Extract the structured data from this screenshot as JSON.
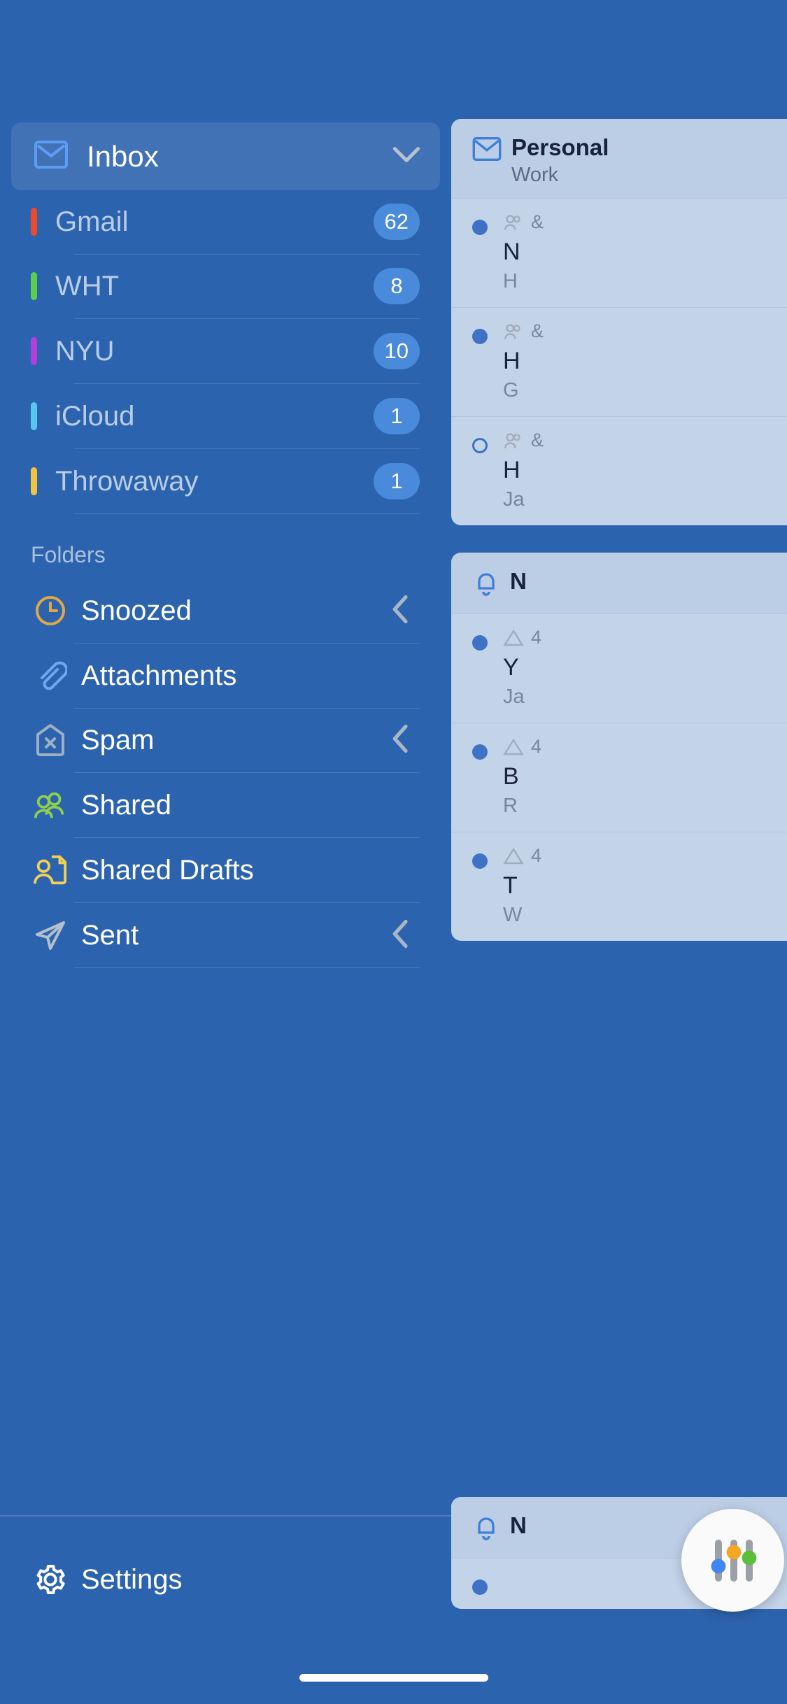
{
  "app": {
    "accent": "#2c63ae",
    "badge_color": "#4a8ada",
    "panel_color": "#c3d3e8"
  },
  "header": {
    "menu_icon": "hamburger-menu-icon"
  },
  "sidebar": {
    "inbox": {
      "label": "Inbox",
      "icon": "envelope-icon",
      "expand_icon": "chevron-down-icon",
      "expanded": true
    },
    "accounts": [
      {
        "label": "Gmail",
        "badge": "62",
        "color": "#f0482a"
      },
      {
        "label": "WHT",
        "badge": "8",
        "color": "#5ad04a"
      },
      {
        "label": "NYU",
        "badge": "10",
        "color": "#b43ddd"
      },
      {
        "label": "iCloud",
        "badge": "1",
        "color": "#56c8ef"
      },
      {
        "label": "Throwaway",
        "badge": "1",
        "color": "#f2c33c"
      }
    ],
    "folders_header": "Folders",
    "folders": [
      {
        "label": "Snoozed",
        "icon": "clock-icon",
        "icon_color": "#e0a845",
        "chevron": true
      },
      {
        "label": "Attachments",
        "icon": "paperclip-icon",
        "icon_color": "#6fa8f0",
        "chevron": false
      },
      {
        "label": "Spam",
        "icon": "spam-shield-x-icon",
        "icon_color": "#9fb0c4",
        "chevron": true
      },
      {
        "label": "Shared",
        "icon": "people-icon",
        "icon_color": "#8ed04a",
        "chevron": false
      },
      {
        "label": "Shared Drafts",
        "icon": "person-document-icon",
        "icon_color": "#f2cf55",
        "chevron": false
      },
      {
        "label": "Sent",
        "icon": "paper-plane-icon",
        "icon_color": "#b3bfcd",
        "chevron": true
      }
    ],
    "settings": {
      "label": "Settings",
      "icon": "gear-icon"
    }
  },
  "email_panel": {
    "cards": [
      {
        "header_icon": "envelope-icon",
        "title": "Personal",
        "subtitle": "Work",
        "messages": [
          {
            "read": false,
            "from_icon": "people-icon",
            "from": "&",
            "subject": "N",
            "snippet": "H"
          },
          {
            "read": false,
            "from_icon": "people-icon",
            "from": "&",
            "subject": "H",
            "snippet": "G"
          },
          {
            "read": true,
            "from_icon": "people-icon",
            "from": "&",
            "subject": "H",
            "snippet": "Ja"
          }
        ]
      },
      {
        "header_icon": "bell-icon",
        "title": "N",
        "subtitle": "",
        "messages": [
          {
            "read": false,
            "from_icon": "warning-icon",
            "from": "4",
            "subject": "Y",
            "snippet": "Ja"
          },
          {
            "read": false,
            "from_icon": "warning-icon",
            "from": "4",
            "subject": "B",
            "snippet": "R"
          },
          {
            "read": false,
            "from_icon": "warning-icon",
            "from": "4",
            "subject": "T",
            "snippet": "W"
          }
        ]
      },
      {
        "header_icon": "bell-icon",
        "title": "N",
        "subtitle": "",
        "messages": [
          {
            "read": false,
            "from_icon": "warning-icon",
            "from": "",
            "subject": "",
            "snippet": ""
          }
        ]
      }
    ]
  },
  "fab": {
    "icon": "sliders-filter-icon",
    "slider_colors": [
      "#4285f4",
      "#f5a623",
      "#5cbf3c"
    ]
  }
}
